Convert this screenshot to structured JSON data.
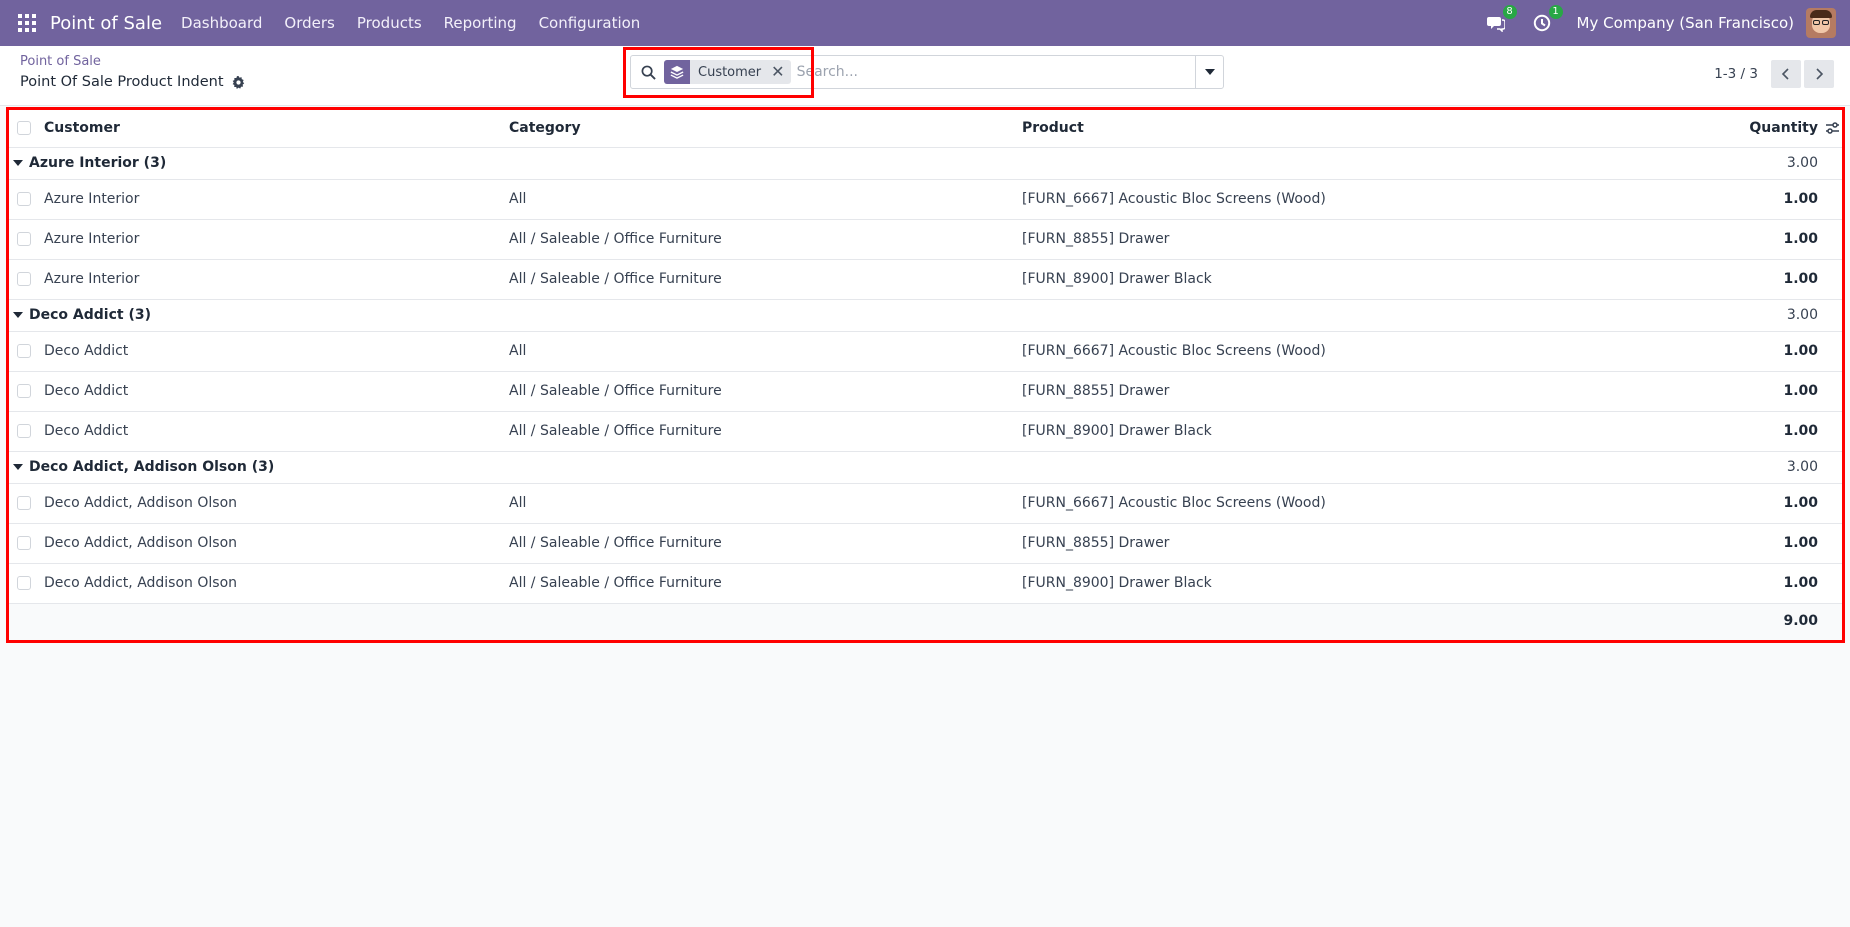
{
  "navbar": {
    "brand": "Point of Sale",
    "menu": [
      "Dashboard",
      "Orders",
      "Products",
      "Reporting",
      "Configuration"
    ],
    "messages_count": "8",
    "activities_count": "1",
    "company": "My Company (San Francisco)"
  },
  "breadcrumb": {
    "parent": "Point of Sale",
    "current": "Point Of Sale Product Indent"
  },
  "search": {
    "facet_label": "Customer",
    "placeholder": "Search..."
  },
  "pager": {
    "value": "1-3 / 3"
  },
  "table": {
    "columns": [
      "Customer",
      "Category",
      "Product",
      "Quantity"
    ],
    "groups": [
      {
        "label": "Azure Interior (3)",
        "total": "3.00",
        "rows": [
          {
            "customer": "Azure Interior",
            "category": "All",
            "product": "[FURN_6667] Acoustic Bloc Screens (Wood)",
            "quantity": "1.00"
          },
          {
            "customer": "Azure Interior",
            "category": "All / Saleable / Office Furniture",
            "product": "[FURN_8855] Drawer",
            "quantity": "1.00"
          },
          {
            "customer": "Azure Interior",
            "category": "All / Saleable / Office Furniture",
            "product": "[FURN_8900] Drawer Black",
            "quantity": "1.00"
          }
        ]
      },
      {
        "label": "Deco Addict (3)",
        "total": "3.00",
        "rows": [
          {
            "customer": "Deco Addict",
            "category": "All",
            "product": "[FURN_6667] Acoustic Bloc Screens (Wood)",
            "quantity": "1.00"
          },
          {
            "customer": "Deco Addict",
            "category": "All / Saleable / Office Furniture",
            "product": "[FURN_8855] Drawer",
            "quantity": "1.00"
          },
          {
            "customer": "Deco Addict",
            "category": "All / Saleable / Office Furniture",
            "product": "[FURN_8900] Drawer Black",
            "quantity": "1.00"
          }
        ]
      },
      {
        "label": "Deco Addict, Addison Olson (3)",
        "total": "3.00",
        "rows": [
          {
            "customer": "Deco Addict, Addison Olson",
            "category": "All",
            "product": "[FURN_6667] Acoustic Bloc Screens (Wood)",
            "quantity": "1.00"
          },
          {
            "customer": "Deco Addict, Addison Olson",
            "category": "All / Saleable / Office Furniture",
            "product": "[FURN_8855] Drawer",
            "quantity": "1.00"
          },
          {
            "customer": "Deco Addict, Addison Olson",
            "category": "All / Saleable / Office Furniture",
            "product": "[FURN_8900] Drawer Black",
            "quantity": "1.00"
          }
        ]
      }
    ],
    "grand_total": "9.00"
  },
  "colors": {
    "navbar": "#71639e",
    "highlight": "#ff0000",
    "badge": "#28a745"
  },
  "icons": [
    "apps-grid-icon",
    "chat-icon",
    "clock-icon",
    "gear-icon",
    "search-icon",
    "layers-icon",
    "close-icon",
    "caret-down-icon",
    "chevron-left-icon",
    "chevron-right-icon",
    "sliders-icon"
  ]
}
